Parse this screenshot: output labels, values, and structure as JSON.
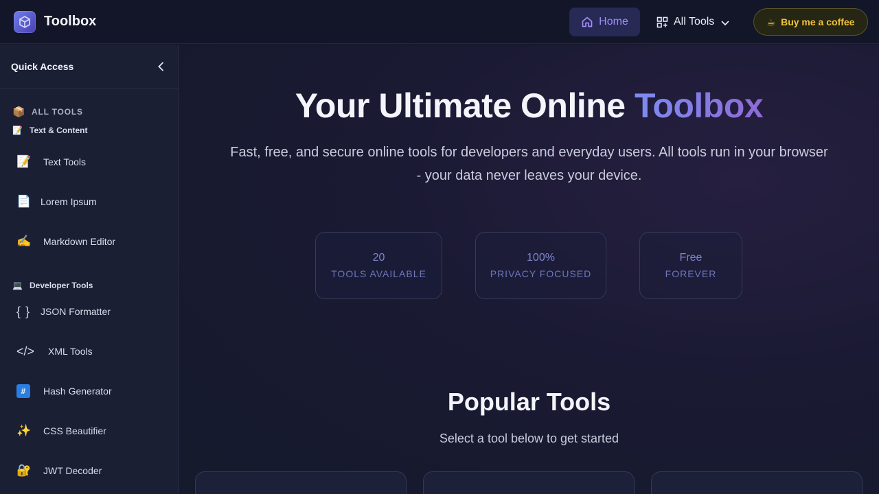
{
  "header": {
    "brand": "Toolbox",
    "nav_home": "Home",
    "nav_all_tools": "All Tools",
    "coffee": "Buy me a coffee"
  },
  "sidebar": {
    "title": "Quick Access",
    "all_tools": "ALL TOOLS",
    "categories": [
      {
        "name": "Text & Content",
        "items": [
          "Text Tools",
          "Lorem Ipsum",
          "Markdown Editor"
        ]
      },
      {
        "name": "Developer Tools",
        "items": [
          "JSON Formatter",
          "XML Tools",
          "Hash Generator",
          "CSS Beautifier",
          "JWT Decoder"
        ]
      }
    ],
    "icons": {
      "all_tools": "📦",
      "text_content": "📝",
      "text_tools": "📝",
      "lorem_ipsum": "📄",
      "markdown_editor": "✍️",
      "developer_tools": "💻",
      "json_formatter": "{ }",
      "xml_tools": "</>",
      "hash_generator": "#",
      "css_beautifier": "✨",
      "jwt_decoder": "🔐"
    }
  },
  "hero": {
    "title_main": "Your Ultimate Online ",
    "title_accent": "Toolbox",
    "subtitle": "Fast, free, and secure online tools for developers and everyday users. All tools run in your browser - your data never leaves your device."
  },
  "stats": [
    {
      "value": "20",
      "label": "TOOLS AVAILABLE"
    },
    {
      "value": "100%",
      "label": "PRIVACY FOCUSED"
    },
    {
      "value": "Free",
      "label": "FOREVER"
    }
  ],
  "popular": {
    "title": "Popular Tools",
    "subtitle": "Select a tool below to get started"
  },
  "colors": {
    "accent": "#a48cf7",
    "coffee": "#f2c43a",
    "background": "#141729"
  }
}
